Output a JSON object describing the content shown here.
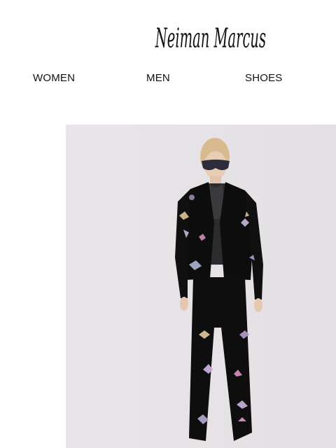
{
  "brand": {
    "logo_text": "Neiman Marcus"
  },
  "nav": {
    "items": [
      {
        "label": "WOMEN"
      },
      {
        "label": "MEN"
      },
      {
        "label": "SHOES"
      }
    ]
  },
  "hero": {
    "background_color": "#e6e2e5",
    "outfit_color": "#0d0d0d"
  }
}
